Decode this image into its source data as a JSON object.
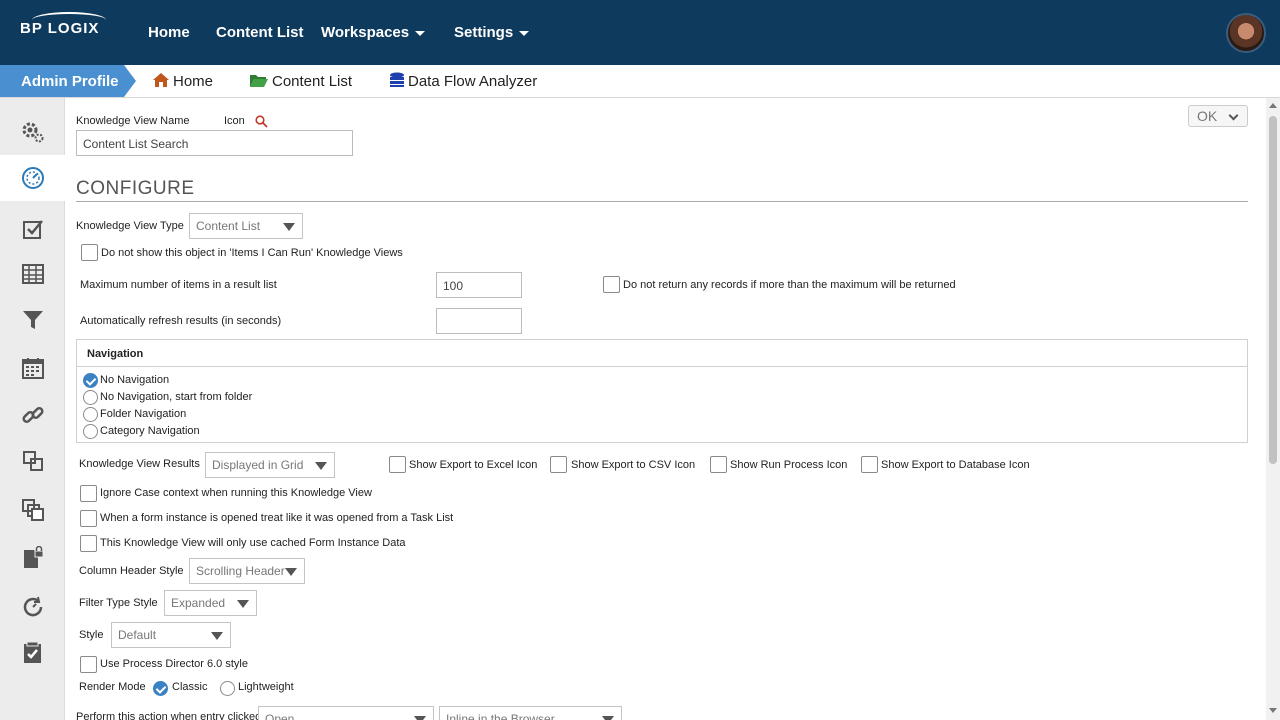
{
  "brand": {
    "logo_text": "BP LOGIX"
  },
  "topnav": {
    "home": "Home",
    "content_list": "Content List",
    "workspaces": "Workspaces",
    "settings": "Settings"
  },
  "breadcrumb": {
    "admin": "Admin Profile",
    "home": "Home",
    "content_list": "Content List",
    "data_flow": "Data Flow Analyzer"
  },
  "sidebar": {
    "icons": [
      "gears-icon",
      "dashboard-icon",
      "checklist-icon",
      "grid-icon",
      "filter-icon",
      "calendar-icon",
      "link-icon",
      "copy-icon",
      "duplicate-icon",
      "locked-document-icon",
      "refresh-gauge-icon",
      "task-check-icon"
    ],
    "active_index": 1
  },
  "form": {
    "kv_name_label": "Knowledge View Name",
    "icon_label": "Icon",
    "kv_name_value": "Content List Search",
    "ok_label": "OK",
    "section_title": "CONFIGURE",
    "kv_type_label": "Knowledge View Type",
    "kv_type_value": "Content List",
    "not_show_label": "Do not show this object in 'Items I Can Run' Knowledge Views",
    "max_items_label": "Maximum number of items in a result list",
    "max_items_value": "100",
    "no_return_label": "Do not return any records if more than the maximum will be returned",
    "auto_refresh_label": "Automatically refresh results (in seconds)",
    "auto_refresh_value": "",
    "navigation": {
      "title": "Navigation",
      "options": [
        "No Navigation",
        "No Navigation, start from folder",
        "Folder Navigation",
        "Category Navigation"
      ],
      "selected": 0
    },
    "kv_results_label": "Knowledge View Results",
    "kv_results_value": "Displayed in Grid",
    "export_excel": "Show Export to Excel Icon",
    "export_csv": "Show Export to CSV Icon",
    "run_process": "Show Run Process Icon",
    "export_db": "Show Export to Database Icon",
    "ignore_case": "Ignore Case context when running this Knowledge View",
    "task_list": "When a form instance is opened treat like it was opened from a Task List",
    "cached": "This Knowledge View will only use cached Form Instance Data",
    "col_header_label": "Column Header Style",
    "col_header_value": "Scrolling Header",
    "filter_type_label": "Filter Type Style",
    "filter_type_value": "Expanded",
    "style_label": "Style",
    "style_value": "Default",
    "pd6_label": "Use Process Director 6.0 style",
    "render_mode_label": "Render Mode",
    "render_classic": "Classic",
    "render_light": "Lightweight",
    "perform_action_label": "Perform this action when entry clicked",
    "perform_action_value": "Open",
    "perform_target_value": "Inline in the Browser"
  },
  "colors": {
    "topbar": "#0e3a5e",
    "accent": "#4a90d0",
    "radio_on": "#3b82c4"
  }
}
